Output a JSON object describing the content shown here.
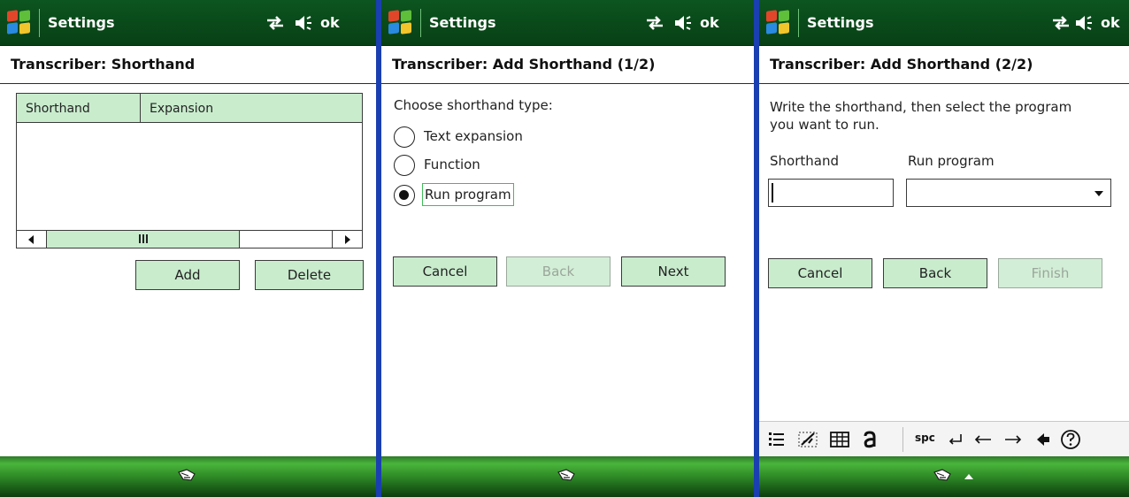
{
  "screens": [
    {
      "titlebar": {
        "app_title": "Settings",
        "ok_label": "ok"
      },
      "header": "Transcriber: Shorthand",
      "list": {
        "columns": [
          "Shorthand",
          "Expansion"
        ]
      },
      "buttons": {
        "add": "Add",
        "delete": "Delete"
      }
    },
    {
      "titlebar": {
        "app_title": "Settings",
        "ok_label": "ok"
      },
      "header": "Transcriber: Add Shorthand (1/2)",
      "prompt": "Choose shorthand type:",
      "options": [
        {
          "label": "Text expansion",
          "checked": false
        },
        {
          "label": "Function",
          "checked": false
        },
        {
          "label": "Run program",
          "checked": true
        }
      ],
      "buttons": {
        "cancel": "Cancel",
        "back": "Back",
        "next": "Next"
      }
    },
    {
      "titlebar": {
        "app_title": "Settings",
        "ok_label": "ok"
      },
      "header": "Transcriber: Add Shorthand (2/2)",
      "instructions_line1": "Write the shorthand, then select the program",
      "instructions_line2": "you want to run.",
      "fields": {
        "shorthand_label": "Shorthand",
        "shorthand_value": "",
        "run_program_label": "Run program",
        "run_program_value": ""
      },
      "buttons": {
        "cancel": "Cancel",
        "back": "Back",
        "finish": "Finish"
      },
      "sip_toolbar": {
        "spc_label": "spc",
        "items": [
          "list-icon",
          "handwriting-icon",
          "keyboard-icon",
          "letter-a-icon",
          "spc",
          "enter-icon",
          "left-arrow-icon",
          "right-arrow-icon",
          "backspace-icon",
          "help-icon"
        ]
      }
    }
  ],
  "colors": {
    "titlebar": "#0a4a1a",
    "button_fill": "#c9eccd",
    "bottombar": "#2e8a26",
    "focus_border": "#3fbf56"
  }
}
